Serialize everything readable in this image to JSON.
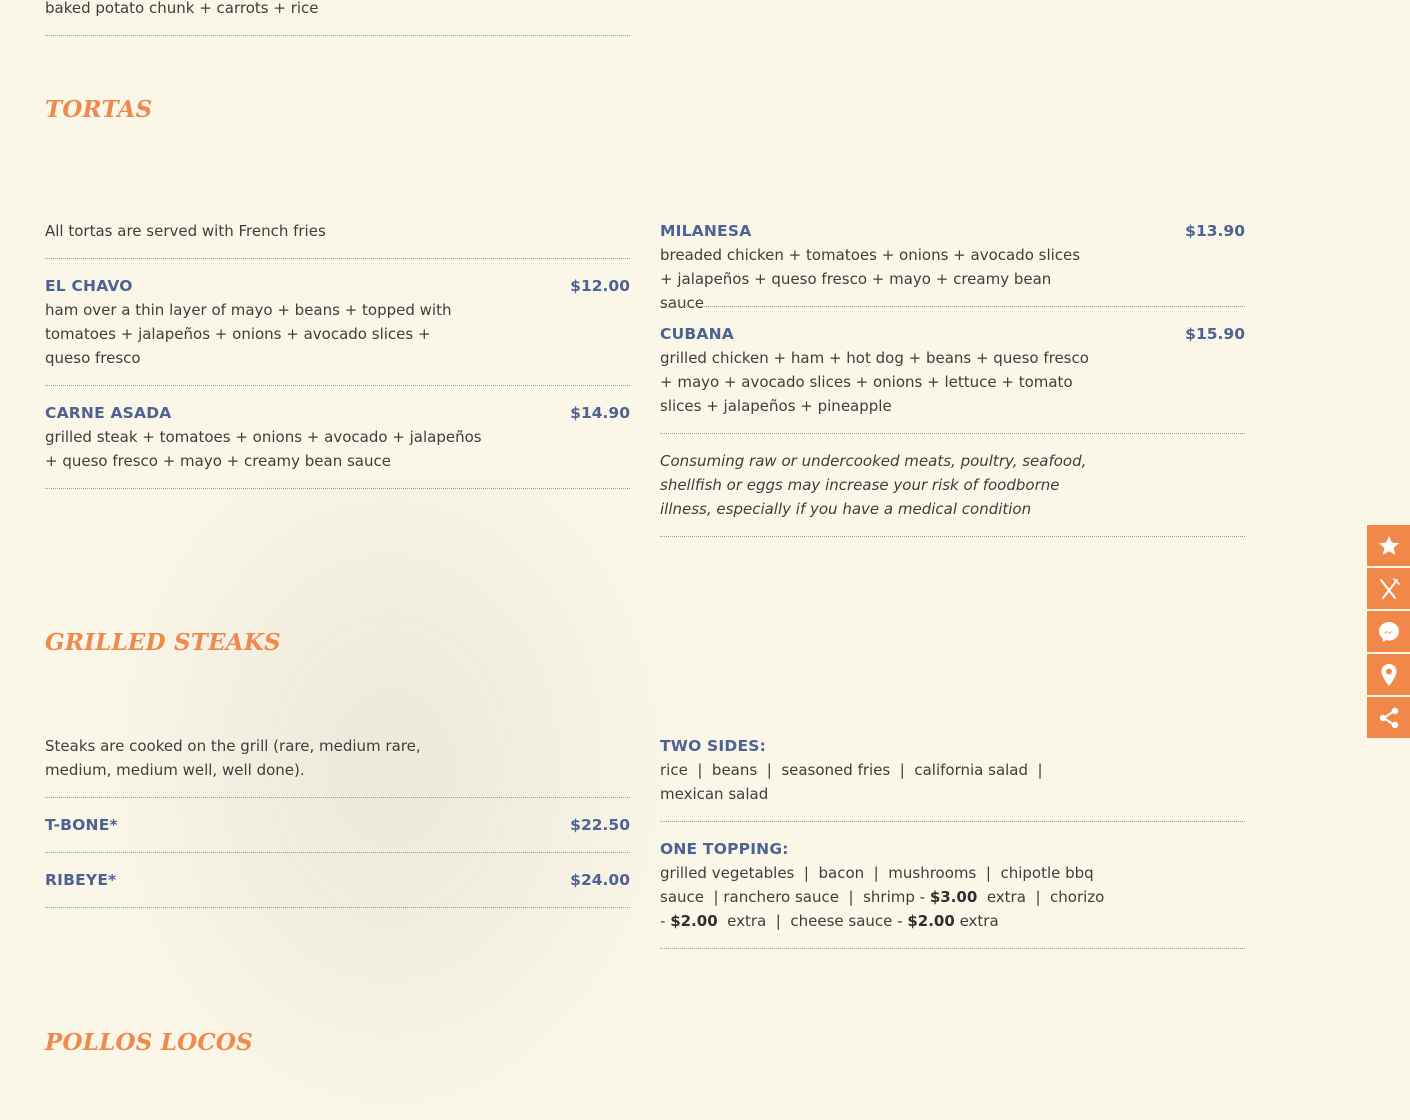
{
  "top": {
    "leftover_desc": "baked potato chunk + carrots + rice"
  },
  "tortas": {
    "title": "TORTAS",
    "note": "All tortas are served with French fries",
    "items_left": [
      {
        "name": "EL CHAVO",
        "price": "$12.00",
        "desc": "ham over a thin layer of mayo + beans + topped with tomatoes + jalapeños + onions + avocado slices + queso fresco"
      },
      {
        "name": "CARNE ASADA",
        "price": "$14.90",
        "desc": "grilled steak + tomatoes + onions + avocado + jalapeños + queso fresco + mayo + creamy bean sauce"
      }
    ],
    "items_right": [
      {
        "name": "MILANESA",
        "price": "$13.90",
        "desc": "breaded chicken + tomatoes + onions + avocado slices + jalapeños + queso fresco + mayo + creamy bean sauce"
      },
      {
        "name": "CUBANA",
        "price": "$15.90",
        "desc": "grilled chicken + ham + hot dog + beans + queso fresco + mayo + avocado slices + onions + lettuce + tomato slices + jalapeños + pineapple"
      }
    ],
    "disclaimer": "Consuming raw or undercooked meats, poultry, seafood, shellfish or eggs may increase your risk of foodborne illness, especially if you have a medical condition"
  },
  "steaks": {
    "title": "GRILLED STEAKS",
    "note": "Steaks are cooked on the grill (rare, medium rare, medium, medium well, well done).",
    "items": [
      {
        "name": "T-BONE*",
        "price": "$22.50"
      },
      {
        "name": "RIBEYE*",
        "price": "$24.00"
      }
    ],
    "two_sides": {
      "label": "TWO SIDES:",
      "desc": "rice  |  beans  |  seasoned fries  |  california salad  |  mexican salad"
    },
    "one_topping": {
      "label": "ONE TOPPING:",
      "part1": "grilled vegetables  |  bacon  |  mushrooms  |  chipotle bbq sauce  | ranchero sauce  |  shrimp - ",
      "price1": "$3.00",
      "part2": "  extra  |  chorizo - ",
      "price2": "$2.00",
      "part3": "  extra  |  cheese sauce - ",
      "price3": "$2.00",
      "part4": " extra"
    }
  },
  "pollos": {
    "title": "POLLOS LOCOS"
  },
  "sidebar": {
    "buttons": [
      {
        "icon": "star-icon"
      },
      {
        "icon": "fork-knife-icon"
      },
      {
        "icon": "messenger-icon"
      },
      {
        "icon": "location-pin-icon"
      },
      {
        "icon": "share-icon"
      }
    ]
  }
}
